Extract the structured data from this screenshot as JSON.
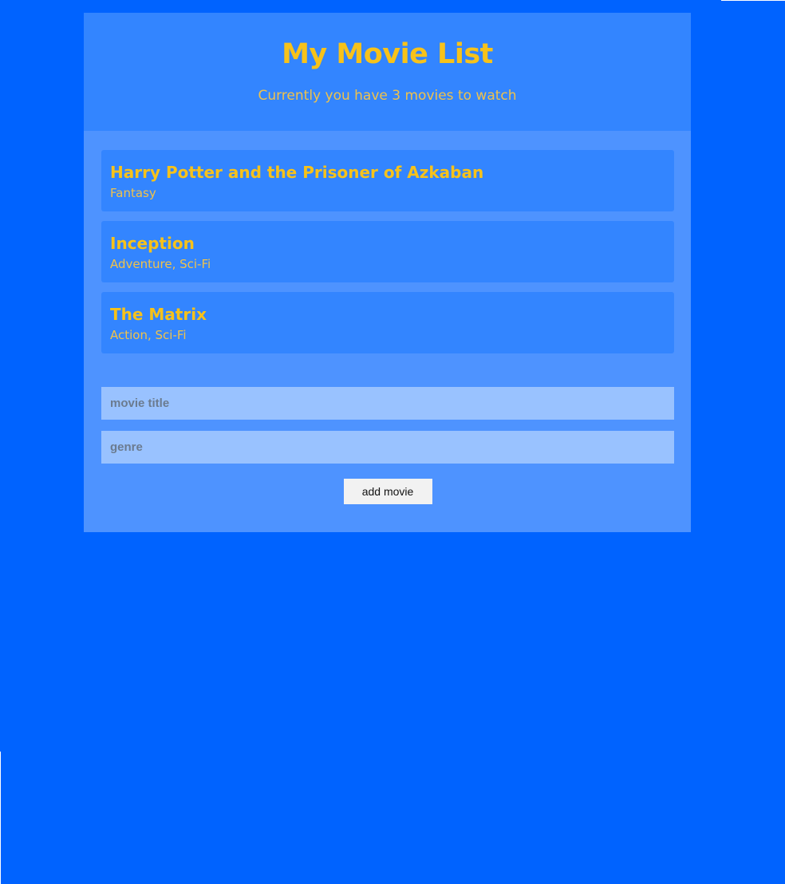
{
  "header": {
    "title": "My Movie List",
    "subtitle": "Currently you have 3 movies to watch"
  },
  "movies": [
    {
      "title": "Harry Potter and the Prisoner of Azkaban",
      "genre": "Fantasy"
    },
    {
      "title": "Inception",
      "genre": "Adventure, Sci-Fi"
    },
    {
      "title": "The Matrix",
      "genre": "Action, Sci-Fi"
    }
  ],
  "form": {
    "title_placeholder": "movie title",
    "title_value": "",
    "genre_placeholder": "genre",
    "genre_value": "",
    "submit_label": "add movie"
  },
  "colors": {
    "page_background": "#0063ff",
    "header_background": "#3385ff",
    "body_background": "#4e93ff",
    "card_background": "#3385ff",
    "accent_text": "#f7c21a",
    "input_background": "#99c2ff",
    "button_background": "#f2f2f2"
  }
}
